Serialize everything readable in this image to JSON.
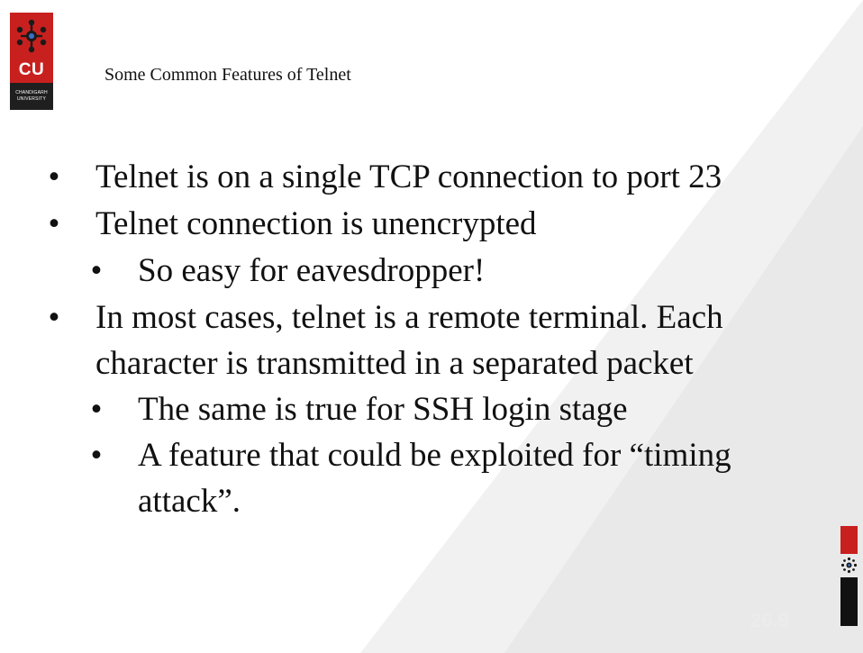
{
  "logo": {
    "initials": "CU",
    "line1": "CHANDIGARH",
    "line2": "UNIVERSITY"
  },
  "slide": {
    "title": "Some Common Features of Telnet",
    "page_number": "26.9",
    "bullets": [
      {
        "marker": "•",
        "text": "Telnet is on a single TCP connection to port 23"
      },
      {
        "marker": "•",
        "text": "Telnet connection is unencrypted"
      },
      {
        "marker": "•",
        "text": "So easy for eavesdropper!"
      },
      {
        "marker": "•",
        "text": "In most cases, telnet is a remote terminal. Each"
      },
      {
        "marker": "",
        "text": "character is transmitted in a separated packet"
      },
      {
        "marker": "•",
        "text": "The same is true for SSH login stage"
      },
      {
        "marker": "•",
        "text": "A feature that could be exploited for “timing"
      },
      {
        "marker": "",
        "text": "attack”."
      }
    ]
  },
  "colors": {
    "brand_red": "#c8201e",
    "brand_black": "#111111",
    "background_shape": "#f1f1f1"
  }
}
